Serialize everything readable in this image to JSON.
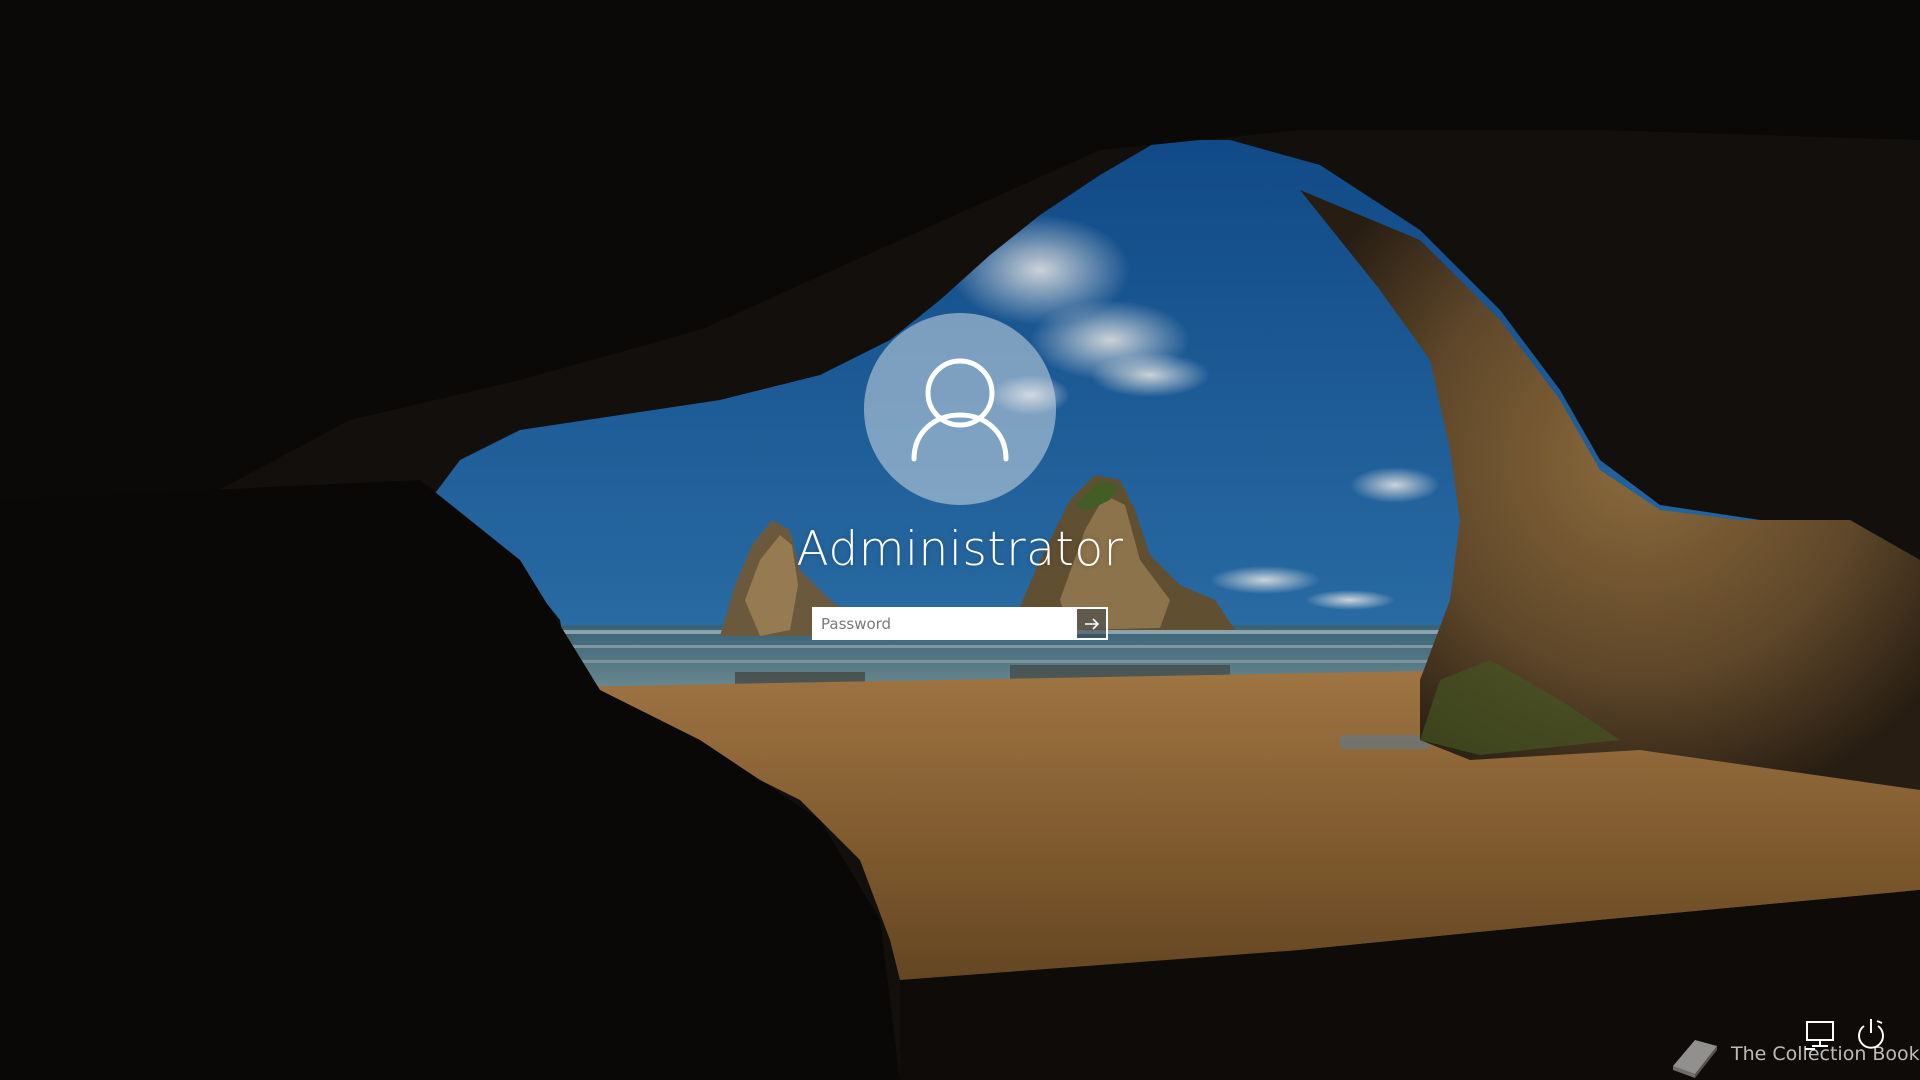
{
  "login": {
    "username": "Administrator",
    "password_placeholder": "Password",
    "password_value": "",
    "avatar_icon": "user-silhouette-icon",
    "submit_icon": "arrow-right-icon"
  },
  "corner_controls": {
    "network_icon": "network-icon",
    "power_icon": "power-icon"
  },
  "watermark": {
    "text": "The Collection Book",
    "logo_icon": "book-icon"
  },
  "colors": {
    "sky": "#1d5fa3",
    "sand": "#9a6a35",
    "cave_rock": "#14110d",
    "avatar_bg": "#c9d4dc"
  }
}
